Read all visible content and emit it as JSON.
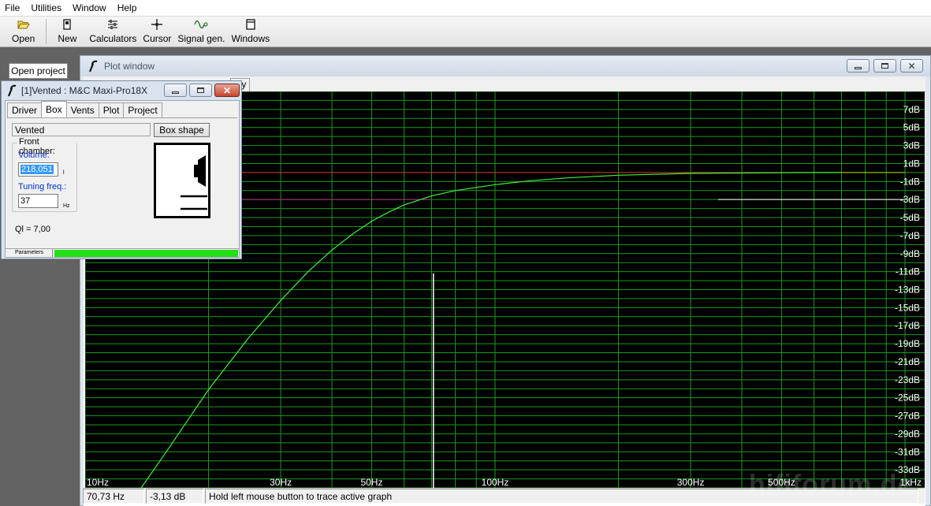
{
  "menu": [
    "File",
    "Utilities",
    "Window",
    "Help"
  ],
  "toolbar": {
    "open": "Open",
    "new": "New",
    "calculators": "Calculators",
    "cursor": "Cursor",
    "signal_gen": "Signal gen.",
    "windows": "Windows"
  },
  "left_panel": {
    "open_project": "Open project"
  },
  "plot_window": {
    "title": "Plot window",
    "tab_fragment": "lay"
  },
  "dialog": {
    "title": "[1]Vented : M&C Maxi-Pro18X",
    "tabs": [
      "Driver",
      "Box",
      "Vents",
      "Plot",
      "Project"
    ],
    "active_tab": "Box",
    "box_type": "Vented",
    "box_shape_button": "Box shape",
    "front_chamber_legend": "Front chamber:",
    "volume_label": "Volume:",
    "volume_value": "218,051",
    "volume_unit": "l",
    "tuning_label": "Tuning freq.:",
    "tuning_value": "37",
    "tuning_unit": "Hz",
    "ql_text": "Ql = 7,00",
    "params_label": "Parameters",
    "params_progress": 1.0
  },
  "chart_data": {
    "type": "line",
    "x_scale": "log",
    "xlim": [
      10,
      1000
    ],
    "ylim": [
      -35,
      9
    ],
    "x_ticks": [
      {
        "value": 10,
        "label": "10Hz"
      },
      {
        "value": 30,
        "label": "30Hz"
      },
      {
        "value": 50,
        "label": "50Hz"
      },
      {
        "value": 100,
        "label": "100Hz"
      },
      {
        "value": 300,
        "label": "300Hz"
      },
      {
        "value": 500,
        "label": "500Hz"
      },
      {
        "value": 1000,
        "label": "1kHz"
      }
    ],
    "y_ticks": [
      {
        "value": 7,
        "label": "7dB"
      },
      {
        "value": 5,
        "label": "5dB"
      },
      {
        "value": 3,
        "label": "3dB"
      },
      {
        "value": 1,
        "label": "1dB"
      },
      {
        "value": -1,
        "label": "-1dB"
      },
      {
        "value": -3,
        "label": "-3dB"
      },
      {
        "value": -5,
        "label": "-5dB"
      },
      {
        "value": -7,
        "label": "-7dB"
      },
      {
        "value": -9,
        "label": "-9dB"
      },
      {
        "value": -11,
        "label": "-11dB"
      },
      {
        "value": -13,
        "label": "-13dB"
      },
      {
        "value": -15,
        "label": "-15dB"
      },
      {
        "value": -17,
        "label": "-17dB"
      },
      {
        "value": -19,
        "label": "-19dB"
      },
      {
        "value": -21,
        "label": "-21dB"
      },
      {
        "value": -23,
        "label": "-23dB"
      },
      {
        "value": -25,
        "label": "-25dB"
      },
      {
        "value": -27,
        "label": "-27dB"
      },
      {
        "value": -29,
        "label": "-29dB"
      },
      {
        "value": -31,
        "label": "-31dB"
      },
      {
        "value": -33,
        "label": "-33dB"
      }
    ],
    "grid": true,
    "background": "#000000",
    "grid_color": "#1a9a1a",
    "series": [
      {
        "color": "#3ef03e",
        "x": [
          13.7,
          16,
          20,
          25,
          30,
          35,
          40,
          45,
          50,
          55,
          60,
          70,
          80,
          100,
          120,
          150,
          200,
          300,
          500,
          700
        ],
        "y": [
          -35,
          -30.6,
          -24.1,
          -18.4,
          -14.2,
          -11,
          -8.6,
          -6.8,
          -5.4,
          -4.4,
          -3.6,
          -2.6,
          -2,
          -1.35,
          -0.95,
          -0.6,
          -0.3,
          -0.1,
          -0.02,
          0
        ]
      }
    ],
    "reference_lines": [
      {
        "value": 0,
        "from": 10,
        "to": 700,
        "color": "#dd2222"
      },
      {
        "value": 0,
        "from": 700,
        "to": 1000,
        "color": "#c8c800"
      },
      {
        "value": -3,
        "from": 10,
        "to": 70,
        "color": "#b02888"
      },
      {
        "value": -3,
        "from": 350,
        "to": 1000,
        "color": "#ffffff"
      }
    ],
    "cursor": {
      "x": 70.73,
      "y": -3.13,
      "color": "#ffffff"
    }
  },
  "status": {
    "freq": "70,73 Hz",
    "level": "-3,13 dB",
    "message": "Hold left mouse button to trace active graph"
  },
  "watermark": "hififorum.de"
}
